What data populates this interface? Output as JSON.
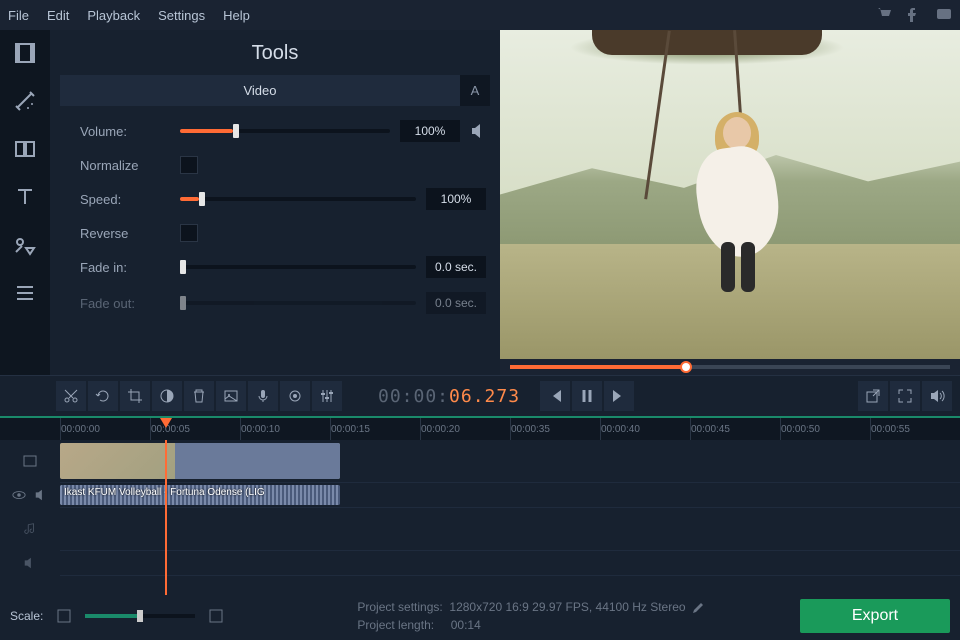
{
  "menu": {
    "file": "File",
    "edit": "Edit",
    "playback": "Playback",
    "settings": "Settings",
    "help": "Help"
  },
  "tools": {
    "title": "Tools",
    "tabs": {
      "video": "Video",
      "audio": "A"
    },
    "volume_label": "Volume:",
    "volume_value": "100%",
    "volume_pct": 25,
    "normalize_label": "Normalize",
    "speed_label": "Speed:",
    "speed_value": "100%",
    "speed_pct": 8,
    "reverse_label": "Reverse",
    "fadein_label": "Fade in:",
    "fadein_value": "0.0 sec.",
    "fadein_pct": 0,
    "fadeout_label": "Fade out:",
    "fadeout_value": "0.0 sec."
  },
  "timecode": {
    "gray": "00:00:",
    "orange": "06.273"
  },
  "ruler": [
    "00:00:00",
    "00:00:05",
    "00:00:10",
    "00:00:15",
    "00:00:20",
    "00:00:35",
    "00:00:40",
    "00:00:45",
    "00:00:50",
    "00:00:55"
  ],
  "clip": {
    "label": "Ikast KFUM Volleyball - Fortuna Odense (LIG"
  },
  "footer": {
    "scale_label": "Scale:",
    "settings_label": "Project settings:",
    "settings_value": "1280x720 16:9 29.97 FPS, 44100 Hz Stereo",
    "length_label": "Project length:",
    "length_value": "00:14",
    "export": "Export"
  }
}
